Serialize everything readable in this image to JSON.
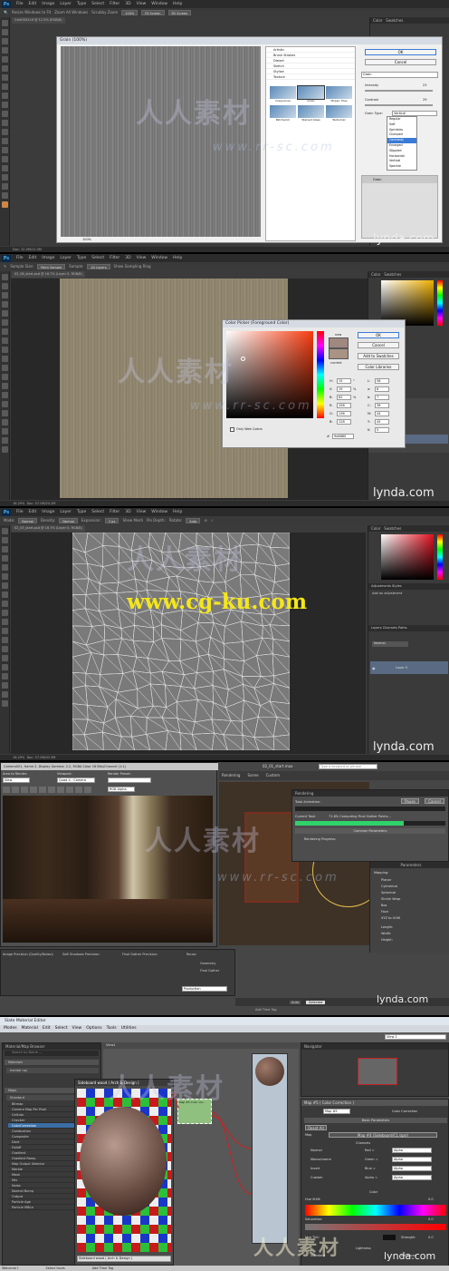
{
  "ps_menus": [
    "File",
    "Edit",
    "Image",
    "Layer",
    "Type",
    "Select",
    "Filter",
    "3D",
    "View",
    "Window",
    "Help"
  ],
  "s1": {
    "ps_label": "Ps",
    "options": [
      "Resize Windows to Fit",
      "Zoom All Windows",
      "Scrubby Zoom",
      "100%",
      "Fit Screen",
      "Fill Screen"
    ],
    "doc_tab": "Grid0003.tif @ 12.5% (RGB/8)",
    "dialog_title": "Grain (100%)",
    "ok": "OK",
    "cancel": "Cancel",
    "filter_select": "Grain",
    "intensity_label": "Intensity",
    "intensity_value": "23",
    "contrast_label": "Contrast",
    "contrast_value": "29",
    "grain_type_label": "Grain Type:",
    "grain_type_value": "Vertical",
    "grain_types": [
      "Regular",
      "Soft",
      "Sprinkles",
      "Clumped",
      "Contrasty",
      "Enlarged",
      "Stippled",
      "Horizontal",
      "Vertical",
      "Speckle"
    ],
    "categories": [
      "Artistic",
      "Brush Strokes",
      "Distort",
      "Sketch",
      "Stylize",
      "Texture"
    ],
    "thumbs": [
      "Craquelure",
      "Grain",
      "Mosaic Tiles",
      "Patchwork",
      "Stained Glass",
      "Texturizer"
    ],
    "layer_name": "Grain",
    "zoom": "100%",
    "status": "Doc: 12.0M/12.0M",
    "brand": "lynda.com",
    "panel_tabs": [
      "Color",
      "Swatches"
    ]
  },
  "s2": {
    "ps_label": "Ps",
    "options": [
      "Sample Size:",
      "Point Sample",
      "Sample:",
      "All Layers",
      "Show Sampling Ring"
    ],
    "doc_tab": "02_06_start.psd @ 16.7% (Layer 0, RGB/8)",
    "dialog_title": "Color Picker (Foreground Color)",
    "ok": "OK",
    "cancel": "Cancel",
    "add_swatches": "Add to Swatches",
    "libraries": "Color Libraries",
    "new_label": "new",
    "current_label": "current",
    "only_web": "Only Web Colors",
    "fields": [
      {
        "k": "H:",
        "v": "15",
        "u": "°"
      },
      {
        "k": "S:",
        "v": "19",
        "u": "%"
      },
      {
        "k": "B:",
        "v": "62",
        "u": "%"
      },
      {
        "k": "R:",
        "v": "158",
        "u": ""
      },
      {
        "k": "G:",
        "v": "136",
        "u": ""
      },
      {
        "k": "B:",
        "v": "128",
        "u": ""
      }
    ],
    "fields2": [
      {
        "k": "L:",
        "v": "58"
      },
      {
        "k": "a:",
        "v": "8"
      },
      {
        "k": "b:",
        "v": "7"
      },
      {
        "k": "C:",
        "v": "36"
      },
      {
        "k": "M:",
        "v": "44"
      },
      {
        "k": "Y:",
        "v": "45"
      },
      {
        "k": "K:",
        "v": "5"
      }
    ],
    "hex": "9e8880",
    "status": "Doc: 57.0M/24.2M",
    "zoom": "16.29%",
    "brand": "lynda.com",
    "panel_tabs": [
      "Color",
      "Swatches"
    ]
  },
  "s3": {
    "ps_label": "Ps",
    "options": [
      "Mode:",
      "Normal",
      "Density:",
      "Normal",
      "Expansion:",
      "2 px",
      "Show Mesh",
      "Pin Depth:",
      "Rotate:",
      "Auto"
    ],
    "doc_tab": "02_03_start.psd @ 16.7% (Layer 0, RGB/8)",
    "promo_url": "www.cg-ku.com",
    "panels": [
      "Color",
      "Swatches",
      "Adjustments",
      "Styles",
      "Add an adjustment",
      "Layers",
      "Channels",
      "Paths"
    ],
    "layer": "Layer 0",
    "blend": "Normal",
    "status": "Doc: 57.0M/42.5M",
    "zoom": "16.29%",
    "brand": "lynda.com"
  },
  "s4": {
    "frame_title": "Camera001, frame 2, Display Gamma: 2.2, RGBA Color 16 Bits/Channel (1:1)",
    "area_label": "Area to Render:",
    "area_value": "View",
    "viewport_label": "Viewport:",
    "viewport_value": "Quad 4 - Camera",
    "preset_label": "Render Preset:",
    "rgb_alpha": "RGB Alpha",
    "max_file": "02_01_start.max",
    "search_placeholder": "Type a keyword or phrase",
    "tabs": [
      "Rendering",
      "Scene",
      "Custom"
    ],
    "rendering_title": "Rendering",
    "total_anim": "Total Animation:",
    "current_task": "Current Task:",
    "task_text": "71.8% Computing Final Gather Points...",
    "pause": "Pause",
    "cancel": "Cancel",
    "common_params": "Common Parameters",
    "rendering_progress": "Rendering Progress:",
    "params_title": "Parameters",
    "mapping": "Mapping:",
    "map_opts": [
      "Planar",
      "Cylindrical",
      "Spherical",
      "Shrink Wrap",
      "Box",
      "Face",
      "XYZ to UVW"
    ],
    "length": "Length:",
    "width": "Width:",
    "height": "Height:",
    "bottom_labels": [
      "Image Precision (Quality/Noise):",
      "Soft Shadows Precision:",
      "Final Gather Precision:",
      "Reuse"
    ],
    "geometry": "Geometry",
    "final_gather": "Final Gather",
    "production": "Production",
    "auto": "Auto",
    "selected": "Selected",
    "add_time_tag": "Add Time Tag",
    "brand": "lynda.com"
  },
  "s5": {
    "title": "Slate Material Editor",
    "menus": [
      "Modes",
      "Material",
      "Edit",
      "Select",
      "View",
      "Options",
      "Tools",
      "Utilities"
    ],
    "browser_title": "Material/Map Browser",
    "search": "Search by Name ...",
    "groups": [
      "Materials",
      "mental ray",
      "Maps",
      "Standard"
    ],
    "maps": [
      "Bitmap",
      "Camera Map Per Pixel",
      "Cellular",
      "Checker",
      "ColorCorrection",
      "Combustion",
      "Composite",
      "Dent",
      "Falloff",
      "Gradient",
      "Gradient Ramp",
      "Map Output Selector",
      "Marble",
      "Mask",
      "Mix",
      "Noise",
      "Normal Bump",
      "Output",
      "Particle Age",
      "Particle MBlur"
    ],
    "selected_map": "ColorCorrection",
    "view_tab": "View1",
    "preview_title": "Sideboard wood ( Arch & Design )",
    "preview_footer": "Sideboard wood ( Arch & Design )",
    "node1": "Map #4 Bitmap",
    "node2": "Map #5 Color Cor...",
    "navigator": "Navigator",
    "map_header": "Map #5 ( Color Correction )",
    "map_name": "Map #5",
    "map_type": "Color Correction",
    "basic_params": "Basic Parameters",
    "reset_all": "Reset All",
    "map_label": "Map",
    "map_value": "Map #4 (Sideboard(CL.tga))",
    "channels_title": "Channels",
    "channels": [
      {
        "k": "Normal",
        "v": "Red =",
        "s": "Alpha"
      },
      {
        "k": "Monochrome",
        "v": "Green =",
        "s": "Alpha"
      },
      {
        "k": "Invert",
        "v": "Blue =",
        "s": "Alpha"
      },
      {
        "k": "Custom",
        "v": "Alpha =",
        "s": "Alpha"
      }
    ],
    "color_title": "Color",
    "hue_shift": "Hue Shift:",
    "saturation": "Saturation:",
    "hue_tint": "Hue Tint:",
    "strength": "Strength:",
    "lightness": "Lightness",
    "standard": "Standard",
    "advanced": "Advanced",
    "status_left": "Welcome t",
    "select_faces": "Select faces",
    "add_time_tag": "Add Time Tag",
    "view_select": "View 1",
    "brand": "lynda.com",
    "hue_shift_v": "0.0",
    "sat_v": "0.0",
    "strength_v": "0.0"
  },
  "watermark": {
    "cn": "人人素材",
    "url": "www.rr-sc.com",
    "cn_bottom": "人人素材"
  }
}
